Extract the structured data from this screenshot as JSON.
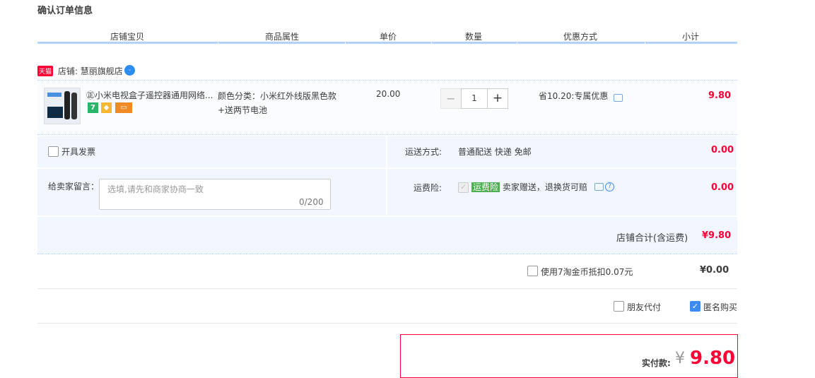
{
  "page_title": "确认订单信息",
  "columns": [
    "店铺宝贝",
    "商品属性",
    "单价",
    "数量",
    "优惠方式",
    "小计"
  ],
  "store": {
    "badge": "天猫",
    "label": "店铺: 慧丽旗舰店"
  },
  "item": {
    "title": "㊣小米电视盒子遥控器通用网络...",
    "service_icons": [
      {
        "name": "seven-day-return-icon",
        "text": "7",
        "color": "#2ab56b"
      },
      {
        "name": "quality-guarantee-icon",
        "text": "",
        "color": "#f5b82e"
      },
      {
        "name": "credit-card-icon",
        "text": "",
        "color": "#f08a24"
      }
    ],
    "spec_line1": "颜色分类：小米红外线版黑色款",
    "spec_line2": "+送两节电池",
    "unit_price": "20.00",
    "quantity": "1",
    "minus": "−",
    "plus": "+",
    "promo": "省10.20:专属优惠",
    "subtotal": "9.80"
  },
  "invoice_label": "开具发票",
  "shipping": {
    "label": "运送方式:",
    "value": "普通配送 快递 免邮",
    "amount": "0.00"
  },
  "message": {
    "label": "给卖家留言：",
    "placeholder": "选填,请先和商家协商一致",
    "count": "0/200"
  },
  "insurance": {
    "label": "运费险:",
    "tag": "运费险",
    "desc": "卖家赠送，退换货可赔",
    "amount": "0.00"
  },
  "store_total": {
    "label": "店铺合计(含运费)",
    "amount": "¥9.80"
  },
  "coins": {
    "label": "使用7淘金币抵扣0.07元",
    "amount": "¥0.00"
  },
  "friend_pay_label": "朋友代付",
  "anonymous_label": "匿名购买",
  "anonymous_checked": true,
  "pay": {
    "label": "实付款:",
    "currency": "¥",
    "amount": "9.80"
  },
  "colors": {
    "accent_red": "#ff0036",
    "header_rule": "#b2d1ff",
    "panel_bg": "#f2f7ff"
  }
}
